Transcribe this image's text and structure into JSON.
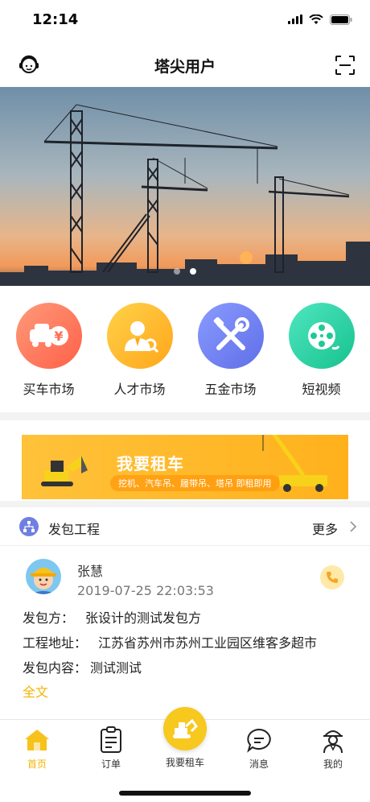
{
  "status_bar": {
    "time": "12:14"
  },
  "nav": {
    "title": "塔尖用户",
    "left_icon": "customer-service-icon",
    "right_icon": "scan-icon"
  },
  "banner": {
    "slides": 2,
    "active_slide": 0
  },
  "categories": [
    {
      "label": "买车市场",
      "icon": "car-market-icon",
      "color": "#ff7a59"
    },
    {
      "label": "人才市场",
      "icon": "talent-icon",
      "color": "#ffb82e"
    },
    {
      "label": "五金市场",
      "icon": "tools-icon",
      "color": "#6c7ef0"
    },
    {
      "label": "短视频",
      "icon": "film-reel-icon",
      "color": "#2fd6a4"
    }
  ],
  "promo": {
    "title": "我要租车",
    "subtitle": "挖机、汽车吊、履带吊、塔吊 即租即用"
  },
  "section": {
    "title": "发包工程",
    "more": "更多"
  },
  "project": {
    "name": "张慧",
    "time": "2019-07-25 22:03:53",
    "rows": [
      {
        "key": "发包方：",
        "value": "张设计的测试发包方"
      },
      {
        "key": "工程地址：",
        "value": "江苏省苏州市苏州工业园区维客多超市"
      },
      {
        "key": "发包内容：",
        "value": "测试测试"
      }
    ],
    "full_text": "全文"
  },
  "tabs": [
    {
      "label": "首页",
      "icon": "home-icon",
      "active": true
    },
    {
      "label": "订单",
      "icon": "orders-icon",
      "active": false
    },
    {
      "label": "我要租车",
      "icon": "excavator-icon",
      "active": false
    },
    {
      "label": "消息",
      "icon": "message-icon",
      "active": false
    },
    {
      "label": "我的",
      "icon": "profile-icon",
      "active": false
    }
  ],
  "colors": {
    "accent": "#f4b400",
    "tab_center": "#f7c81e"
  }
}
